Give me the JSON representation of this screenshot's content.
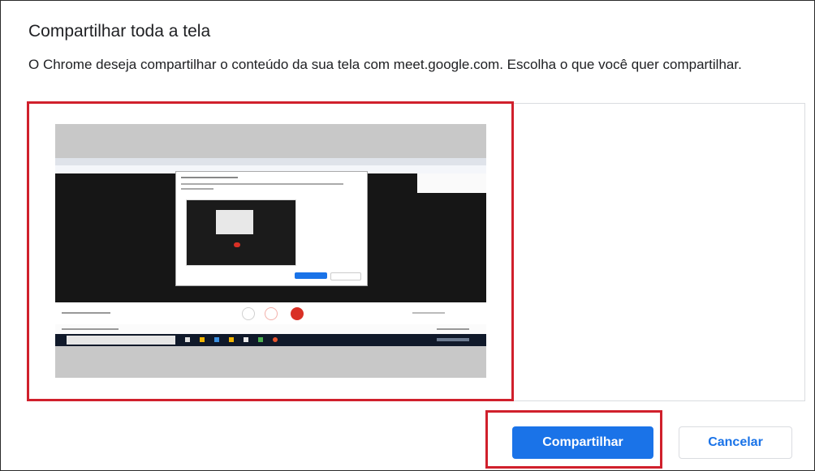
{
  "dialog": {
    "title": "Compartilhar toda a tela",
    "subtitle": "O Chrome deseja compartilhar o conteúdo da sua tela com meet.google.com. Escolha o que você quer compartilhar."
  },
  "buttons": {
    "share_label": "Compartilhar",
    "cancel_label": "Cancelar"
  },
  "colors": {
    "accent": "#1a73e8",
    "highlight": "#d0202c",
    "text": "#202124"
  },
  "preview": {
    "selected": true
  }
}
